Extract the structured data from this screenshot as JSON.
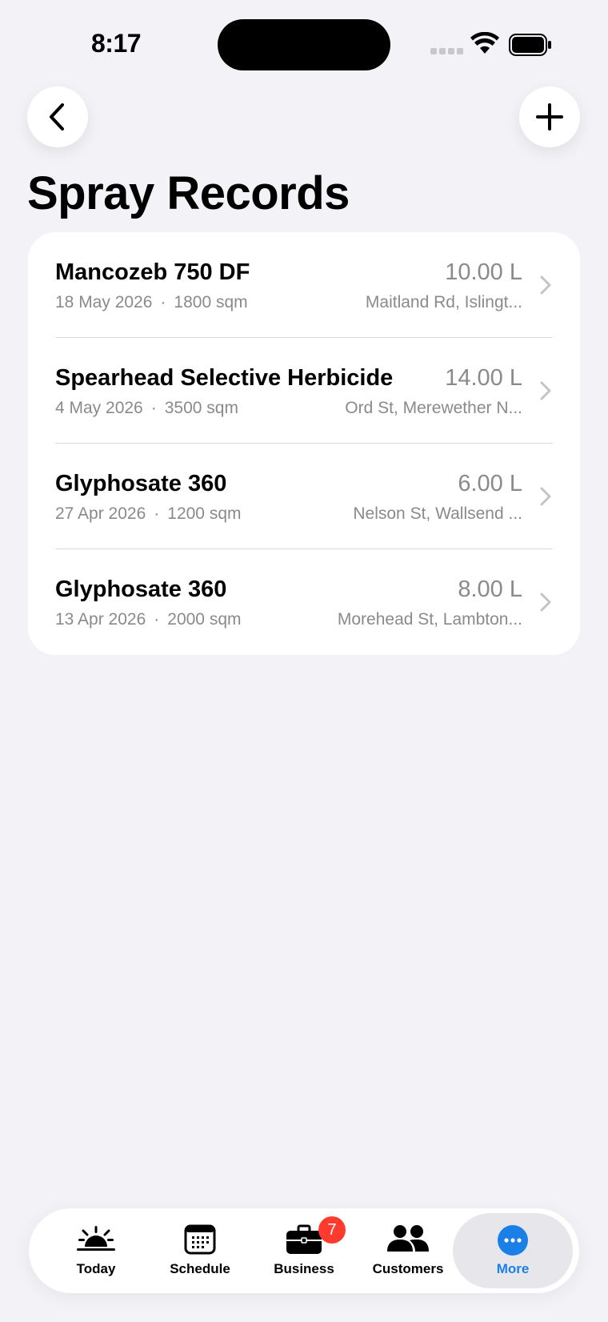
{
  "status": {
    "time": "8:17"
  },
  "page": {
    "title": "Spray Records"
  },
  "records": [
    {
      "name": "Mancozeb 750 DF",
      "date": "18 May 2026",
      "area": "1800 sqm",
      "volume": "10.00 L",
      "address": "Maitland Rd, Islingt..."
    },
    {
      "name": "Spearhead Selective Herbicide",
      "date": "4 May 2026",
      "area": "3500 sqm",
      "volume": "14.00 L",
      "address": "Ord St, Merewether N..."
    },
    {
      "name": "Glyphosate 360",
      "date": "27 Apr 2026",
      "area": "1200 sqm",
      "volume": "6.00 L",
      "address": "Nelson St, Wallsend ..."
    },
    {
      "name": "Glyphosate 360",
      "date": "13 Apr 2026",
      "area": "2000 sqm",
      "volume": "8.00 L",
      "address": "Morehead St, Lambton..."
    }
  ],
  "meta_separator": "·",
  "tabs": [
    {
      "label": "Today",
      "icon": "sunrise-icon"
    },
    {
      "label": "Schedule",
      "icon": "calendar-icon"
    },
    {
      "label": "Business",
      "icon": "briefcase-icon",
      "badge": "7"
    },
    {
      "label": "Customers",
      "icon": "people-icon"
    },
    {
      "label": "More",
      "icon": "more-icon",
      "active": true
    }
  ],
  "colors": {
    "accent": "#1a7fe6",
    "badge": "#ff3b30",
    "background": "#f2f2f7"
  }
}
